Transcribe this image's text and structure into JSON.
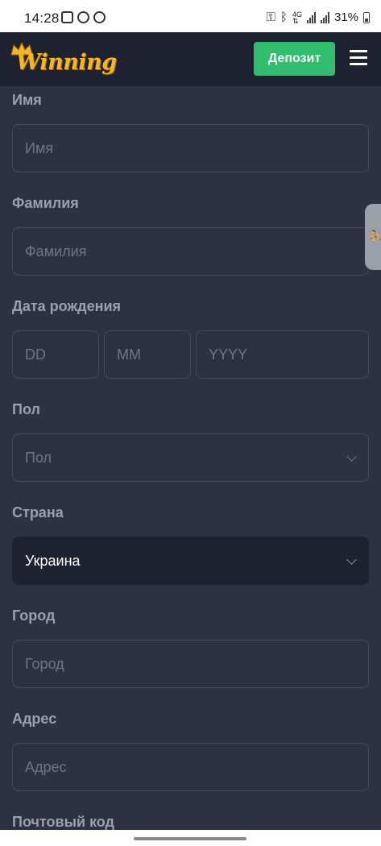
{
  "status_bar": {
    "time": "14:28",
    "battery": "31%",
    "icons": [
      "gallery-icon",
      "viber-icon",
      "lock-app-icon",
      "key-icon",
      "bluetooth-icon",
      "4g-icon",
      "signal-icon",
      "signal-icon",
      "battery-icon"
    ]
  },
  "header": {
    "logo_text": "Winning",
    "deposit_label": "Депозит",
    "menu_icon": "hamburger-icon"
  },
  "form": {
    "first_name": {
      "label": "Имя",
      "placeholder": "Имя"
    },
    "last_name": {
      "label": "Фамилия",
      "placeholder": "Фамилия"
    },
    "birth_date": {
      "label": "Дата рождения",
      "day": "DD",
      "month": "MM",
      "year": "YYYY"
    },
    "gender": {
      "label": "Пол",
      "placeholder": "Пол"
    },
    "country": {
      "label": "Страна",
      "value": "Украина"
    },
    "city": {
      "label": "Город",
      "placeholder": "Город"
    },
    "address": {
      "label": "Адрес",
      "placeholder": "Адрес"
    },
    "postal_code": {
      "label": "Почтовый код"
    }
  },
  "colors": {
    "background": "#2d3142",
    "header": "#1e2130",
    "deposit_button": "#2fbd6e",
    "logo": "#f5b71c"
  }
}
